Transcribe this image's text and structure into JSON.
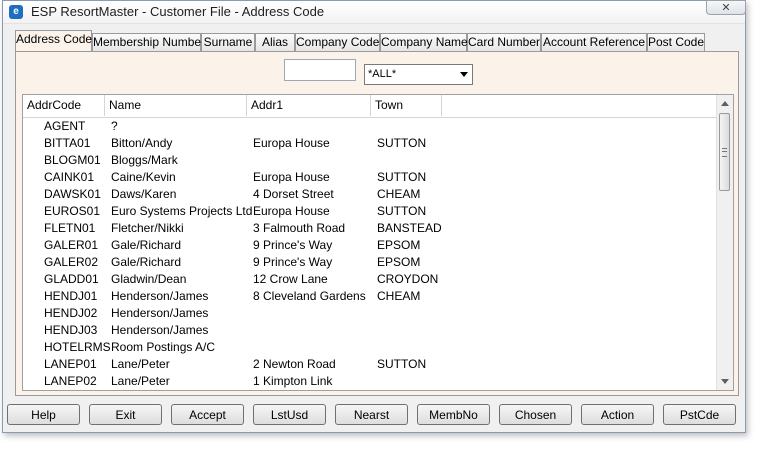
{
  "window": {
    "title": "ESP ResortMaster - Customer File - Address Code",
    "app_icon_glyph": "e",
    "close_glyph": "✕"
  },
  "tabs": [
    {
      "label": "Address Code",
      "active": true
    },
    {
      "label": "Membership Number"
    },
    {
      "label": "Surname"
    },
    {
      "label": "Alias"
    },
    {
      "label": "Company Code"
    },
    {
      "label": "Company Name"
    },
    {
      "label": "Card Number"
    },
    {
      "label": "Account Reference"
    },
    {
      "label": "Post Code"
    }
  ],
  "filter": {
    "search_value": "",
    "select_value": "*ALL*"
  },
  "grid": {
    "columns": [
      "AddrCode",
      "Name",
      "Addr1",
      "Town"
    ],
    "rows": [
      [
        "AGENT",
        "?",
        "",
        ""
      ],
      [
        "BITTA01",
        "Bitton/Andy",
        "Europa House",
        "SUTTON"
      ],
      [
        "BLOGM01",
        "Bloggs/Mark",
        "",
        ""
      ],
      [
        "CAINK01",
        "Caine/Kevin",
        "Europa House",
        "SUTTON"
      ],
      [
        "DAWSK01",
        "Daws/Karen",
        "4 Dorset Street",
        "CHEAM"
      ],
      [
        "EUROS01",
        "Euro Systems Projects Ltd",
        "Europa House",
        "SUTTON"
      ],
      [
        "FLETN01",
        "Fletcher/Nikki",
        "3 Falmouth Road",
        "BANSTEAD"
      ],
      [
        "GALER01",
        "Gale/Richard",
        "9 Prince's Way",
        "EPSOM"
      ],
      [
        "GALER02",
        "Gale/Richard",
        "9 Prince's Way",
        "EPSOM"
      ],
      [
        "GLADD01",
        "Gladwin/Dean",
        "12 Crow Lane",
        "CROYDON"
      ],
      [
        "HENDJ01",
        "Henderson/James",
        "8 Cleveland Gardens",
        "CHEAM"
      ],
      [
        "HENDJ02",
        "Henderson/James",
        "",
        ""
      ],
      [
        "HENDJ03",
        "Henderson/James",
        "",
        ""
      ],
      [
        "HOTELRMS",
        "Room Postings A/C",
        "",
        ""
      ],
      [
        "LANEP01",
        "Lane/Peter",
        "2 Newton Road",
        "SUTTON"
      ],
      [
        "LANEP02",
        "Lane/Peter",
        "1 Kimpton Link",
        ""
      ]
    ]
  },
  "buttons": [
    {
      "label": "Help",
      "name": "help-button"
    },
    {
      "label": "Exit",
      "name": "exit-button"
    },
    {
      "label": "Accept",
      "name": "accept-button"
    },
    {
      "label": "LstUsd",
      "name": "lstusd-button"
    },
    {
      "label": "Nearst",
      "name": "nearst-button"
    },
    {
      "label": "MembNo",
      "name": "membno-button"
    },
    {
      "label": "Chosen",
      "name": "chosen-button"
    },
    {
      "label": "Action",
      "name": "action-button"
    },
    {
      "label": "PstCde",
      "name": "pstcde-button"
    }
  ]
}
